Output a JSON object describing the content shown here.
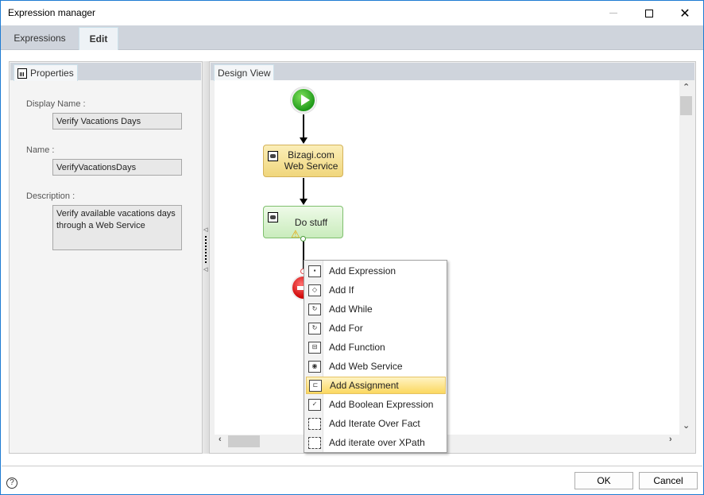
{
  "window": {
    "title": "Expression manager",
    "controls": {
      "minimize": "—",
      "maximize": "□",
      "close": "✕"
    }
  },
  "tabs": [
    {
      "label": "Expressions",
      "active": false
    },
    {
      "label": "Edit",
      "active": true
    }
  ],
  "properties": {
    "tab_label": "Properties",
    "fields": [
      {
        "label": "Display Name :",
        "value": "Verify Vacations Days"
      },
      {
        "label": "Name :",
        "value": "VerifyVacationsDays"
      },
      {
        "label": "Description :",
        "value": "Verify available vacations days through a Web Service"
      }
    ]
  },
  "design_view": {
    "tab_label": "Design View",
    "nodes": [
      {
        "type": "start",
        "label": ""
      },
      {
        "type": "web-service",
        "label": "Bizagi.com Web Service"
      },
      {
        "type": "expression",
        "label": "Do stuff",
        "warning": true
      },
      {
        "type": "end",
        "label": ""
      }
    ],
    "scroll_arrows": {
      "up": "⌃",
      "down": "⌄",
      "left": "‹",
      "right": "›"
    }
  },
  "context_menu": {
    "items": [
      {
        "label": "Add Expression",
        "icon": "expression-icon"
      },
      {
        "label": "Add If",
        "icon": "if-icon"
      },
      {
        "label": "Add While",
        "icon": "while-icon"
      },
      {
        "label": "Add For",
        "icon": "for-icon"
      },
      {
        "label": "Add Function",
        "icon": "function-icon"
      },
      {
        "label": "Add Web Service",
        "icon": "web-service-icon"
      },
      {
        "label": "Add Assignment",
        "icon": "assignment-icon",
        "highlighted": true
      },
      {
        "label": "Add Boolean Expression",
        "icon": "boolean-icon"
      },
      {
        "label": "Add Iterate Over Fact",
        "icon": "iterate-fact-icon"
      },
      {
        "label": "Add iterate over XPath",
        "icon": "iterate-xpath-icon"
      }
    ]
  },
  "footer": {
    "help": "?",
    "ok_label": "OK",
    "cancel_label": "Cancel"
  }
}
